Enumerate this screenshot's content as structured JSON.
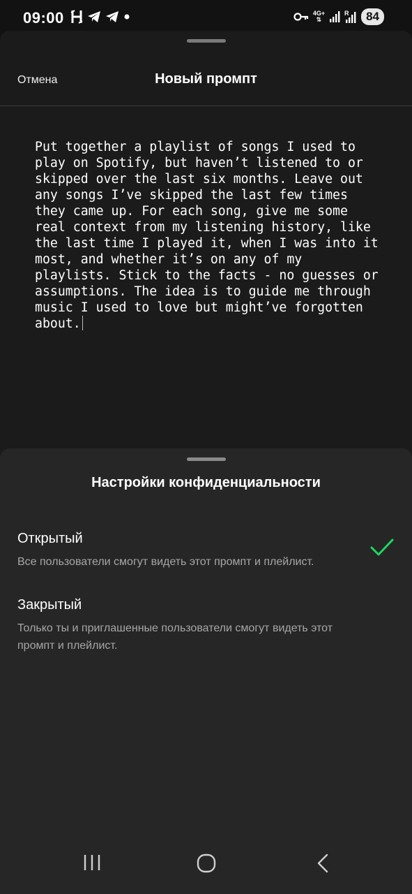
{
  "status_bar": {
    "time": "09:00",
    "network_top": "4G+",
    "battery": "84",
    "notification_icons": [
      "h-app-icon",
      "telegram-icon",
      "telegram-icon",
      "dot-icon"
    ],
    "right_icons": [
      "key-icon",
      "signal-4g-icon",
      "signal-bars-icon",
      "signal-roaming-icon"
    ]
  },
  "header": {
    "cancel_label": "Отмена",
    "title": "Новый промпт"
  },
  "prompt": {
    "text": "Put together a playlist of songs I used to play on Spotify, but haven’t listened to or skipped over the last six months. Leave out any songs I’ve skipped the last few times they came up. For each song, give me some real context from my listening history, like the last time I played it, when I was into it most, and whether it’s on any of my playlists. Stick to the facts - no guesses or assumptions. The idea is to guide me through music I used to love but might’ve forgotten about."
  },
  "privacy": {
    "title": "Настройки конфиденциальности",
    "options": [
      {
        "title": "Открытый",
        "description": "Все пользователи смогут видеть этот промпт и плейлист.",
        "selected": true
      },
      {
        "title": "Закрытый",
        "description": "Только ты и приглашенные пользователи смогут видеть этот промпт и плейлист.",
        "selected": false
      }
    ],
    "check_color": "#1ed760"
  },
  "nav_bar": {
    "buttons": [
      "recent-apps-icon",
      "home-icon",
      "back-icon"
    ]
  }
}
